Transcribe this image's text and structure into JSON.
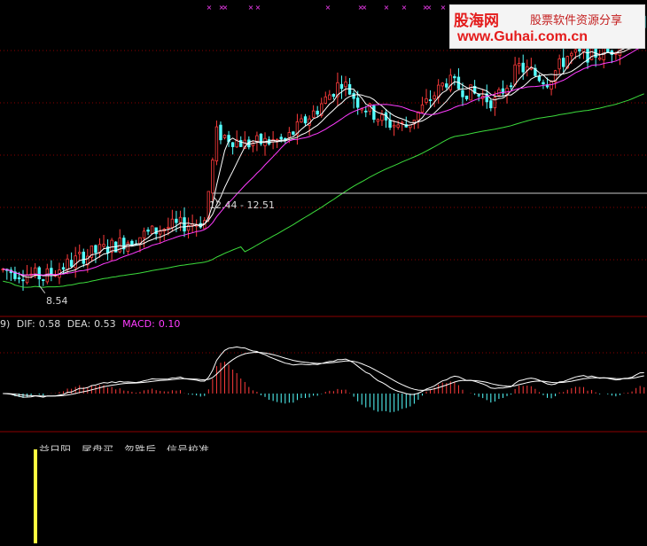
{
  "brand": {
    "name": "股海网",
    "slogan": "股票软件资源分享",
    "url": "www.Guhai.com.cn",
    "colors": {
      "text": "#e41c1c",
      "bg": "#f4f4f4"
    }
  },
  "indicator_text": "益日阳，尾盘买，忽跌后，信号校准",
  "chart_data": [
    {
      "type": "candlestick",
      "panel": "price",
      "x_count": 160,
      "ylim": [
        7.8,
        16.5
      ],
      "annotations": [
        {
          "text": "8.54",
          "index": 10,
          "value": 8.54,
          "kind": "low"
        },
        {
          "text": "12.44 - 12.51",
          "value": 12.47,
          "kind": "price-band"
        }
      ],
      "colors": {
        "up": "#ff3b3b",
        "down": "#54ffff",
        "ma_fast": "#ffffff",
        "ma_slow": "#ffffff",
        "ma_mid": "#ff3bff",
        "ma_long": "#3cdc3c",
        "band": "#c8c8c8",
        "grid": "#8b0000"
      }
    },
    {
      "type": "macd",
      "panel": "macd",
      "legend": {
        "prefix": "9)",
        "dif_label": "DIF:",
        "dif_value": "0.58",
        "dea_label": "DEA:",
        "dea_value": "0.53",
        "macd_label": "MACD:",
        "macd_value": "0.10"
      },
      "ylim": [
        -0.4,
        0.8
      ],
      "colors": {
        "dif": "#ffffff",
        "dea": "#ffffff",
        "pos": "#ff3b3b",
        "neg": "#54ffff",
        "label_dif": "#d8d8d8",
        "label_macd": "#ff3bff"
      }
    },
    {
      "type": "bar",
      "panel": "signal",
      "signals": [
        {
          "index": 7,
          "value": 1.0
        }
      ],
      "colors": {
        "signal": "#ffff40"
      }
    }
  ]
}
